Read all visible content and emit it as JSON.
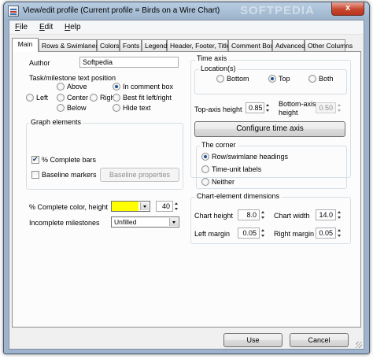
{
  "window": {
    "title": "View/edit profile (Current profile = Birds on a Wire Chart)",
    "watermark": "SOFTPEDIA",
    "close_label": "x"
  },
  "menu": {
    "file_u": "F",
    "file_rest": "ile",
    "edit_u": "E",
    "edit_rest": "dit",
    "help_u": "H",
    "help_rest": "elp"
  },
  "tabs": [
    "Main",
    "Rows & Swimlanes",
    "Colors",
    "Fonts",
    "Legend",
    "Header, Footer, Title",
    "Comment Boxes",
    "Advanced",
    "Other Columns"
  ],
  "main": {
    "author_label": "Author",
    "author_value": "Softpedia",
    "task_position": {
      "title": "Task/milestone text position",
      "above": "Above",
      "left": "Left",
      "center": "Center",
      "right": "Right",
      "below": "Below",
      "in_comment_box": "In comment box",
      "best_fit": "Best fit left/right",
      "hide_text": "Hide text",
      "selected": "In comment box"
    },
    "graph_elements": {
      "title": "Graph elements",
      "pct_complete_bars": "% Complete bars",
      "pct_complete_checked": true,
      "baseline_markers": "Baseline markers",
      "baseline_checked": false,
      "baseline_properties": "Baseline properties"
    },
    "complete_color_label": "% Complete color, height",
    "complete_color": "#ffff00",
    "complete_height": "40",
    "incomplete_label": "Incomplete milestones",
    "incomplete_value": "Unfilled"
  },
  "time_axis": {
    "title": "Time axis",
    "locations_label": "Location(s)",
    "bottom": "Bottom",
    "top": "Top",
    "both": "Both",
    "selected": "Top",
    "top_height_label": "Top-axis height",
    "top_height_value": "0.85",
    "bottom_height_label_1": "Bottom-axis",
    "bottom_height_label_2": "height",
    "bottom_height_value": "0.50",
    "configure_button": "Configure time axis",
    "corner": {
      "title": "The corner",
      "row_headings": "Row/swimlane headings",
      "time_unit_labels": "Time-unit labels",
      "neither": "Neither",
      "selected": "Row/swimlane headings"
    }
  },
  "chart_dims": {
    "title": "Chart-element dimensions",
    "chart_height_label": "Chart height",
    "chart_height_value": "8.0",
    "chart_width_label": "Chart width",
    "chart_width_value": "14.0",
    "left_margin_label": "Left margin",
    "left_margin_value": "0.05",
    "right_margin_label": "Right margin",
    "right_margin_value": "0.05"
  },
  "footer": {
    "use_label": "Use",
    "cancel_label": "Cancel"
  }
}
